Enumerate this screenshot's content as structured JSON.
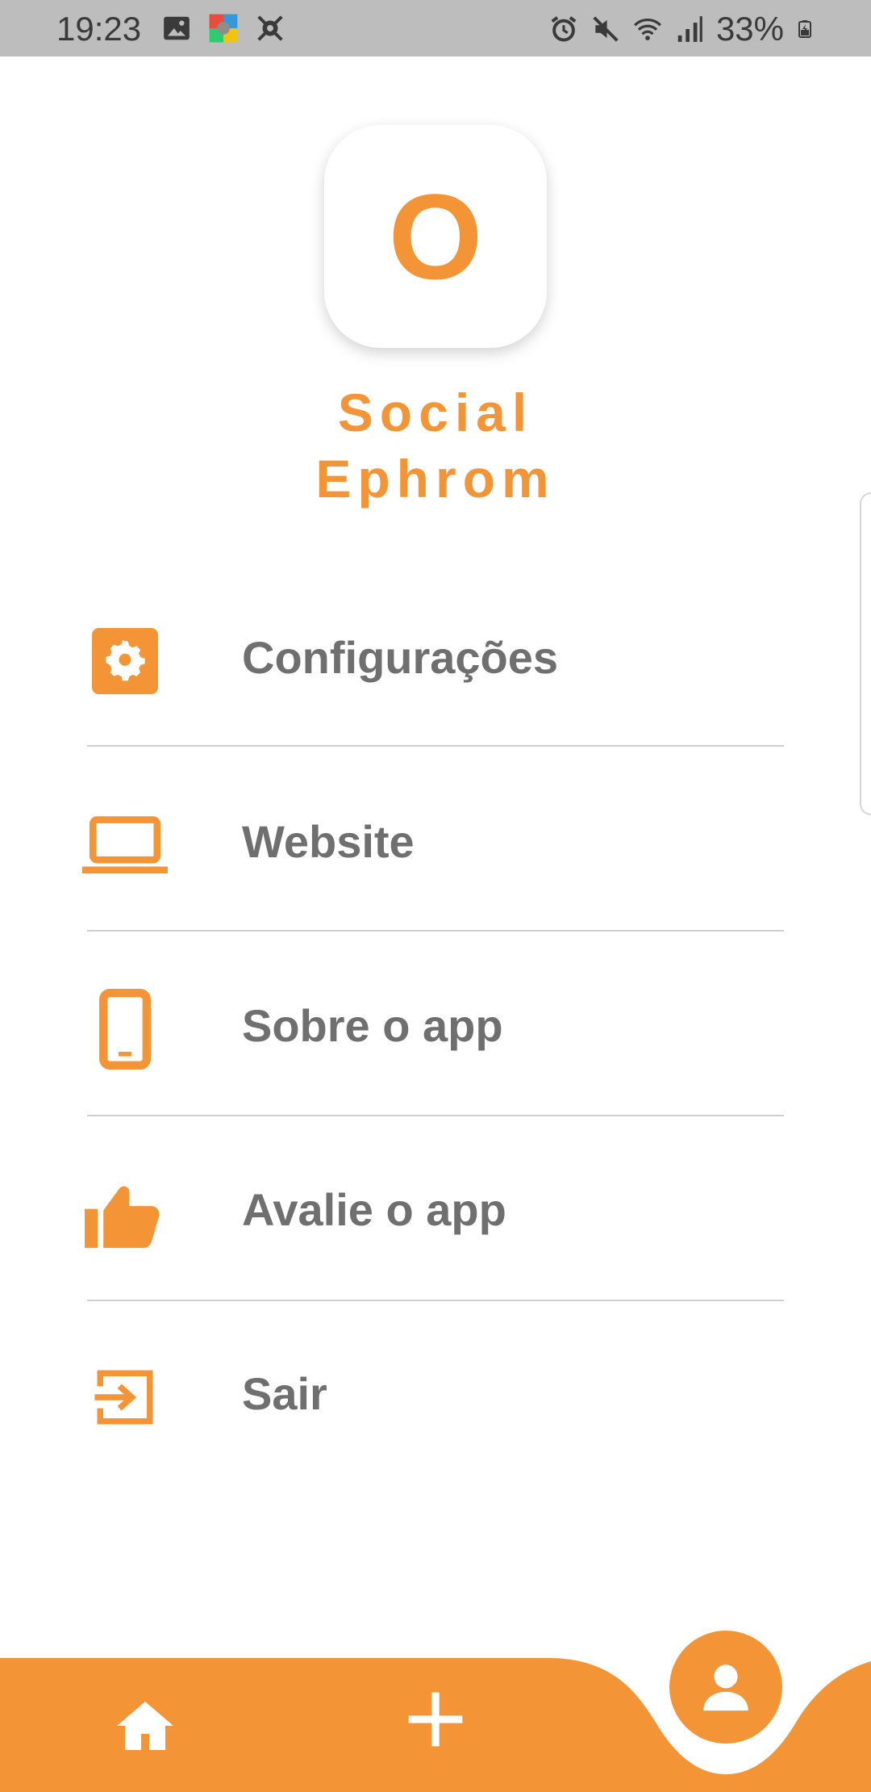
{
  "status_bar": {
    "time": "19:23",
    "battery": "33%",
    "left_icons": [
      "image-icon",
      "app-colorful-icon",
      "bug-icon"
    ],
    "right_icons": [
      "alarm-icon",
      "mute-icon",
      "wifi-icon",
      "signal-icon",
      "battery-icon"
    ]
  },
  "logo": {
    "letter": "O"
  },
  "app_name": {
    "line1": "Social",
    "line2": "Ephrom"
  },
  "menu": {
    "items": [
      {
        "label": "Configurações",
        "icon": "gear-icon"
      },
      {
        "label": "Website",
        "icon": "laptop-icon"
      },
      {
        "label": "Sobre o app",
        "icon": "phone-icon"
      },
      {
        "label": "Avalie o app",
        "icon": "thumbs-up-icon"
      },
      {
        "label": "Sair",
        "icon": "exit-icon"
      }
    ]
  },
  "bottom_nav": {
    "items": [
      {
        "icon": "home-icon"
      },
      {
        "icon": "plus-icon"
      },
      {
        "icon": "profile-icon"
      }
    ]
  },
  "colors": {
    "accent": "#f39436",
    "text": "#6f6f6f",
    "status_bar": "#bdbdbd"
  }
}
